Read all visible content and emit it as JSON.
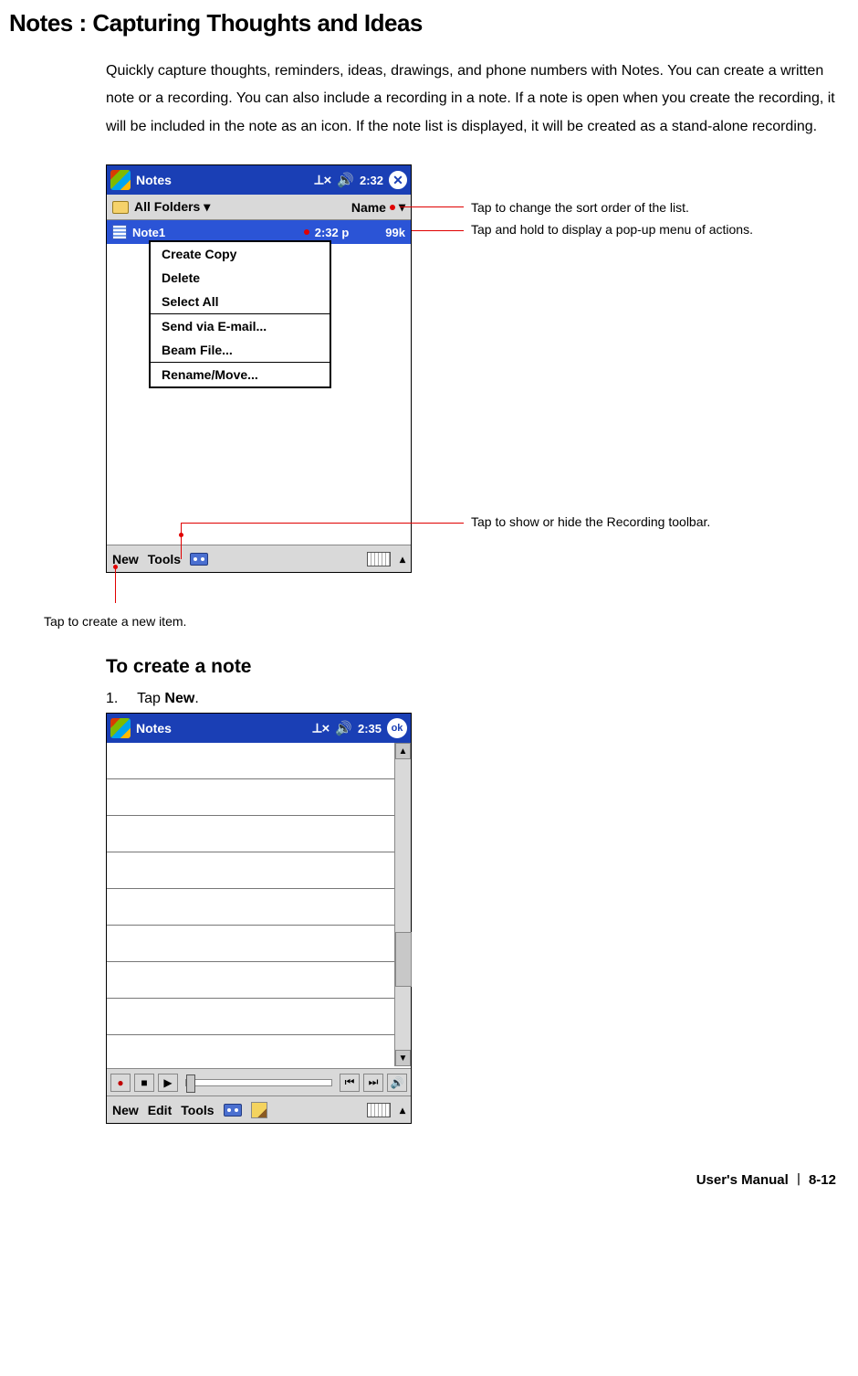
{
  "heading": "Notes : Capturing Thoughts and Ideas",
  "intro": "Quickly capture thoughts, reminders, ideas, drawings, and phone numbers with Notes. You can create a written note or a recording. You can also include a recording in a note. If a note is open when you create the recording, it will be included in the note as an icon. If the note list is displayed, it will be created as a stand-alone recording.",
  "screenshot1": {
    "title": "Notes",
    "time": "2:32",
    "close": "✕",
    "folder_label": "All Folders",
    "folder_caret": "▾",
    "sort_label": "Name",
    "sort_caret": "▾",
    "note_name": "Note1",
    "note_time": "2:32 p",
    "note_size": "99k",
    "context_menu": [
      "Create Copy",
      "Delete",
      "Select All",
      "Send via E-mail...",
      "Beam File...",
      "Rename/Move..."
    ],
    "bottom_new": "New",
    "bottom_tools": "Tools",
    "kbd_caret": "▴"
  },
  "callouts": {
    "sort": "Tap to change the sort order of the list.",
    "hold": "Tap and hold to display a pop-up menu of actions.",
    "recbar": "Tap to show or hide the Recording toolbar.",
    "newitem": "Tap to create a new item."
  },
  "subheading": "To create a note",
  "step1_num": "1.",
  "step1_a": "Tap ",
  "step1_b": "New",
  "step1_c": ".",
  "screenshot2": {
    "title": "Notes",
    "time": "2:35",
    "ok": "ok",
    "bottom_new": "New",
    "bottom_edit": "Edit",
    "bottom_tools": "Tools",
    "kbd_caret": "▴",
    "scroll_up": "▲",
    "scroll_down": "▼",
    "rec": "●",
    "stop": "■",
    "play": "▶",
    "prev": "⏮",
    "next": "⏭",
    "vol": "🔊"
  },
  "footer_a": "User's Manual ",
  "footer_b": "8-12"
}
